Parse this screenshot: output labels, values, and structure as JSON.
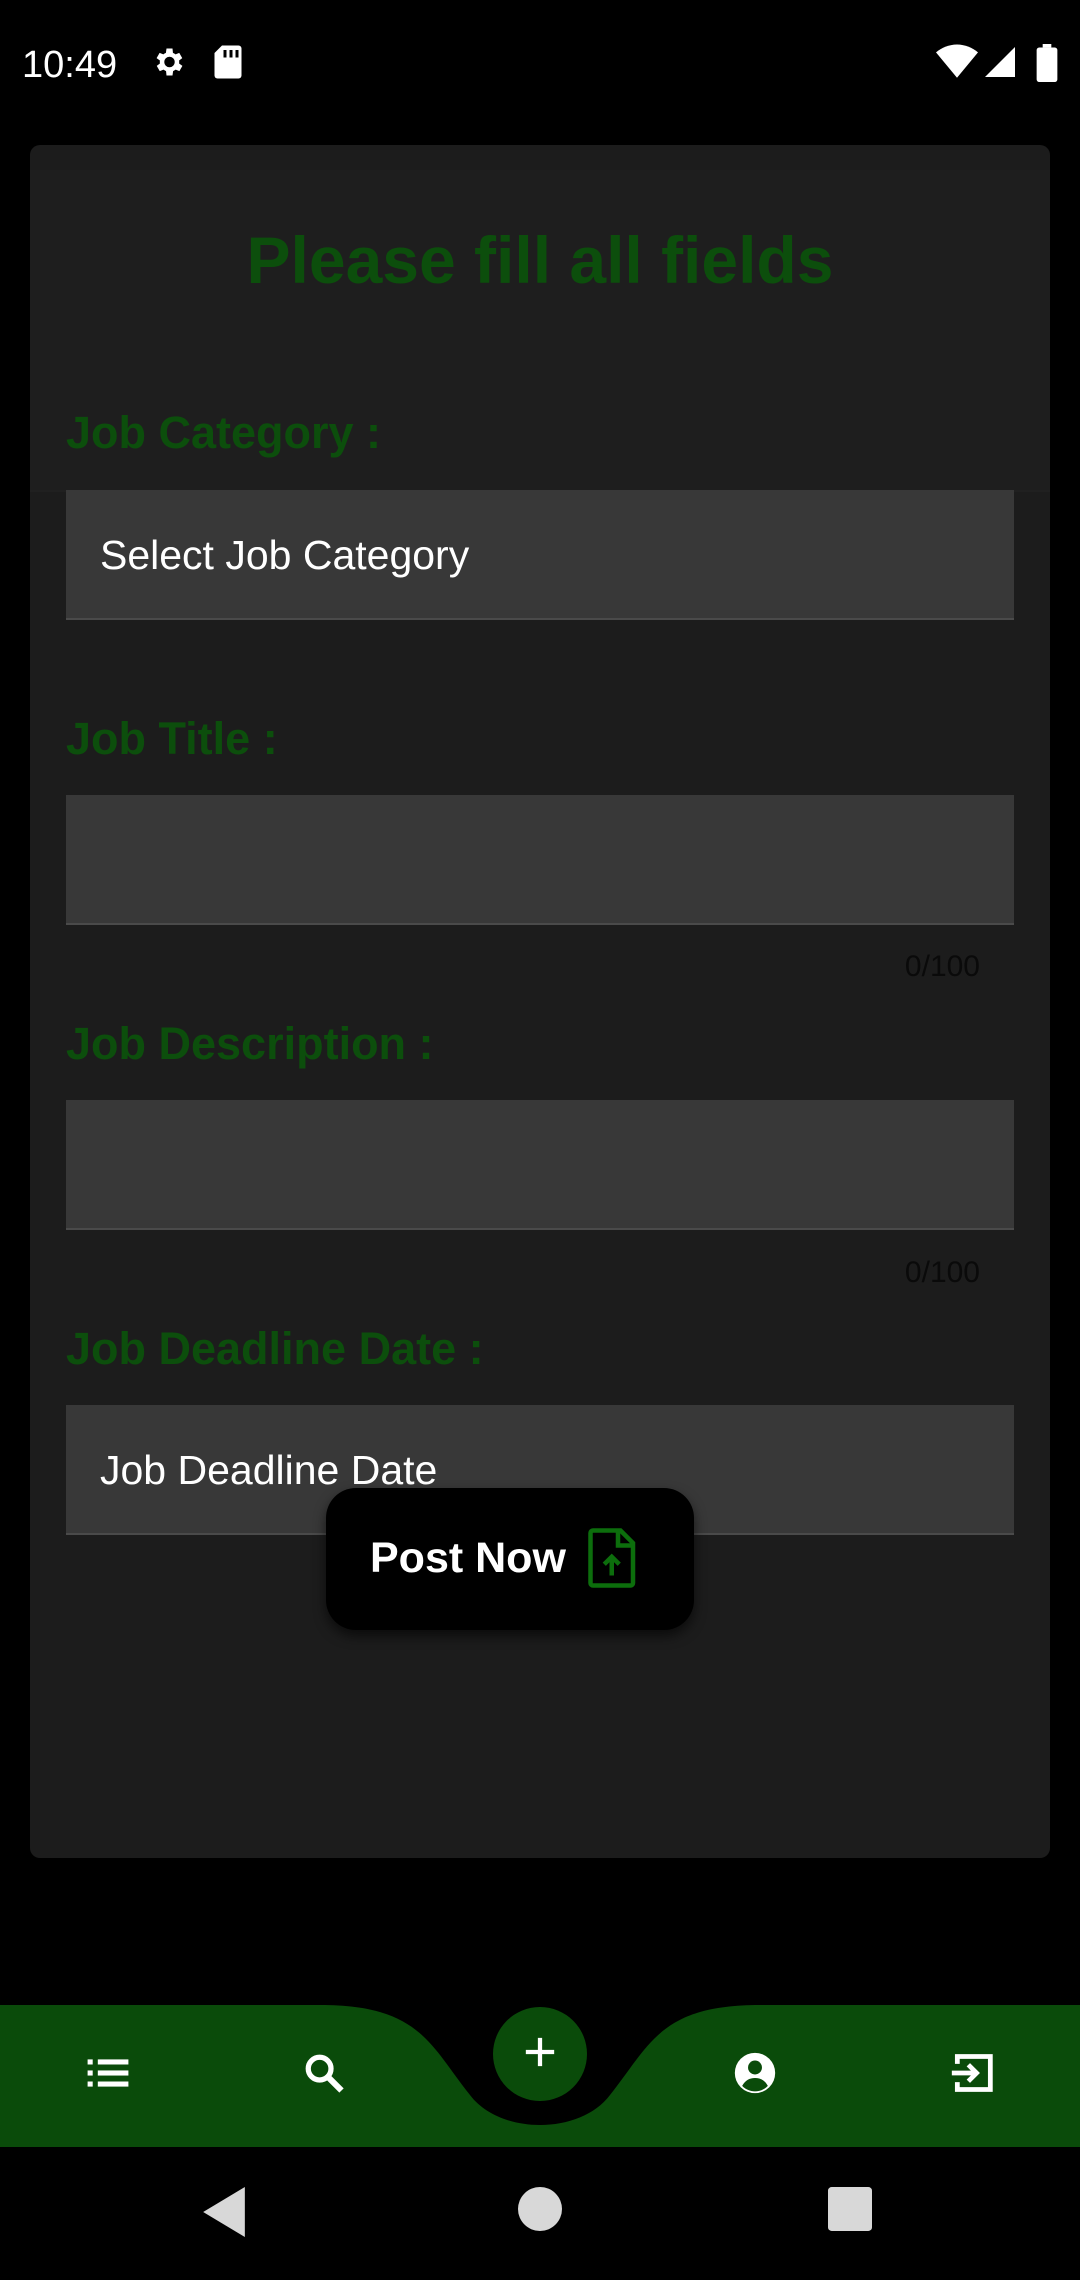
{
  "status_bar": {
    "time": "10:49",
    "icons": [
      "settings-icon",
      "sd-card-icon",
      "wifi-icon",
      "signal-icon",
      "battery-icon"
    ]
  },
  "form": {
    "title": "Please fill all fields",
    "job_category": {
      "label": "Job Category :",
      "value": "Select Job Category"
    },
    "job_title": {
      "label": "Job Title :",
      "value": "",
      "counter": "0/100"
    },
    "job_description": {
      "label": "Job Description :",
      "value": "",
      "counter": "0/100"
    },
    "job_deadline": {
      "label": "Job Deadline Date :",
      "value": "Job Deadline Date"
    },
    "post_button": {
      "label": "Post Now",
      "icon": "file-upload-icon"
    }
  },
  "bottom_nav": {
    "items": [
      "list-icon",
      "search-icon",
      "add-icon",
      "account-icon",
      "logout-icon"
    ]
  },
  "system_nav": [
    "back-icon",
    "home-icon",
    "recents-icon"
  ],
  "colors": {
    "accent": "#0c4e0c",
    "nav_green": "#0a4b0a",
    "card_bg": "#1c1c1c",
    "field_bg": "#383838"
  }
}
